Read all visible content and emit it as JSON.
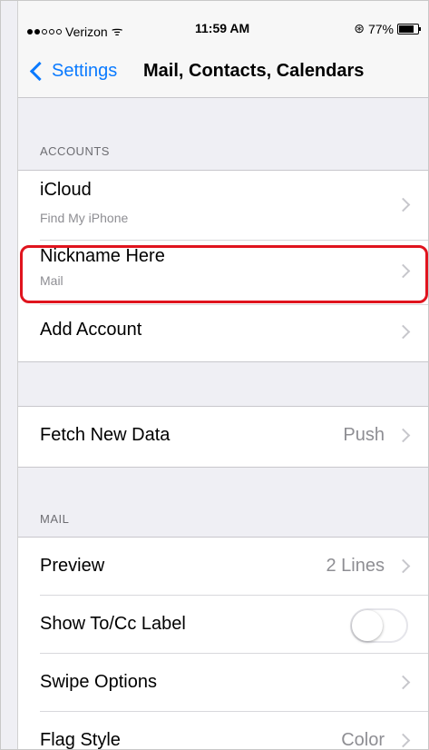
{
  "status_bar": {
    "carrier": "Verizon",
    "time": "11:59 AM",
    "battery": "77%",
    "signal_bars": 2
  },
  "nav": {
    "back_label": "Settings",
    "title": "Mail, Contacts, Calendars"
  },
  "sections": {
    "accounts_header": "ACCOUNTS",
    "mail_header": "MAIL"
  },
  "accounts": [
    {
      "label": "iCloud",
      "sub": "Find My iPhone"
    },
    {
      "label": "Nickname Here",
      "sub": "Mail"
    },
    {
      "label": "Add Account"
    }
  ],
  "fetch": {
    "label": "Fetch New Data",
    "value": "Push"
  },
  "mail": [
    {
      "label": "Preview",
      "value": "2 Lines"
    },
    {
      "label": "Show To/Cc Label"
    },
    {
      "label": "Swipe Options"
    },
    {
      "label": "Flag Style",
      "value": "Color"
    }
  ],
  "colors": {
    "accent": "#0a7aff",
    "highlight": "#e0141e"
  }
}
